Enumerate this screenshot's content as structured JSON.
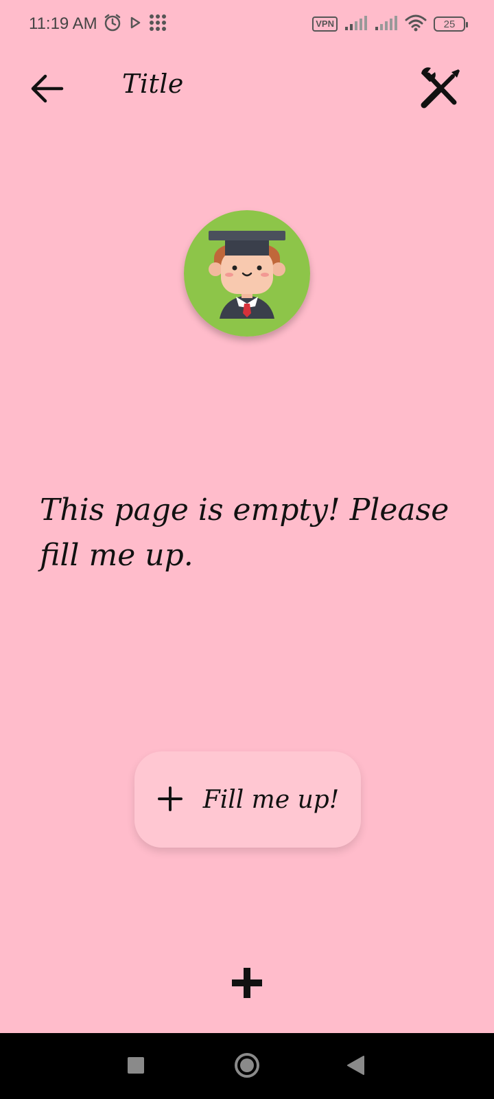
{
  "status_bar": {
    "time": "11:19 AM",
    "vpn": "VPN",
    "battery": "25",
    "icons": [
      "alarm-icon",
      "play-icon",
      "apps-grid-icon",
      "signal-icon",
      "signal-icon",
      "wifi-icon",
      "battery-icon"
    ]
  },
  "app_bar": {
    "title": "Title",
    "back_icon": "arrow-left-icon",
    "tools_icon": "tools-icon"
  },
  "main": {
    "avatar": "graduate-avatar",
    "empty_message": "This page is empty! Please fill me up.",
    "fill_button_label": "Fill me up!",
    "fill_button_icon": "plus-icon"
  },
  "bottom": {
    "add_icon": "plus-bold-icon"
  },
  "nav": {
    "recents_icon": "square-icon",
    "home_icon": "circle-icon",
    "back_icon": "triangle-back-icon"
  },
  "colors": {
    "background": "#FFBCCB",
    "button_bg": "#FFC7D2",
    "avatar_bg": "#8DC549",
    "nav_bar": "#000000"
  }
}
